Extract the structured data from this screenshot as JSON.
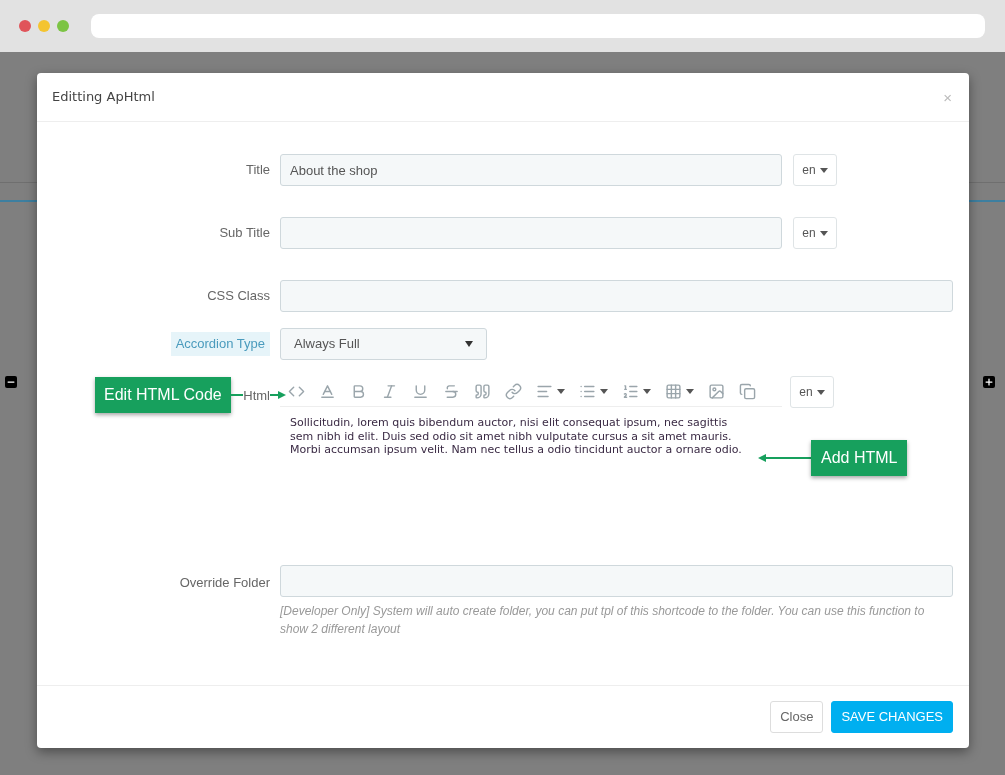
{
  "modal": {
    "title": "Editting ApHtml",
    "close": "×"
  },
  "fields": [
    {
      "kind": "text",
      "label": "Title",
      "value": "About the shop",
      "lang": "en",
      "highlighted": false
    },
    {
      "kind": "text",
      "label": "Sub Title",
      "lang": "en",
      "highlighted": false
    },
    {
      "kind": "wide",
      "label": "CSS Class",
      "highlighted": false
    },
    {
      "kind": "select",
      "label": "Accordion Type",
      "value": "Always Full",
      "highlighted": true
    }
  ],
  "editor": {
    "label": "Html",
    "content": "Sollicitudin, lorem quis bibendum auctor, nisi elit consequat ipsum, nec sagittis sem nibh id elit. Duis sed odio sit amet nibh vulputate cursus a sit amet mauris. Morbi accumsan ipsum velit. Nam nec tellus a odio tincidunt auctor a ornare odio.",
    "lang": "en"
  },
  "override": {
    "label": "Override Folder",
    "help": "[Developer Only] System will auto create folder, you can put tpl of this shortcode to the folder. You can use this function to show 2 different layout"
  },
  "footer": {
    "buttons": [
      {
        "label": "Close",
        "kind": "default"
      },
      {
        "label": "SAVE CHANGES",
        "kind": "primary"
      }
    ]
  },
  "callouts": [
    {
      "text": "Edit HTML Code",
      "kind": "arrow-right"
    },
    {
      "text": "Add HTML",
      "kind": "arrow-left"
    }
  ]
}
